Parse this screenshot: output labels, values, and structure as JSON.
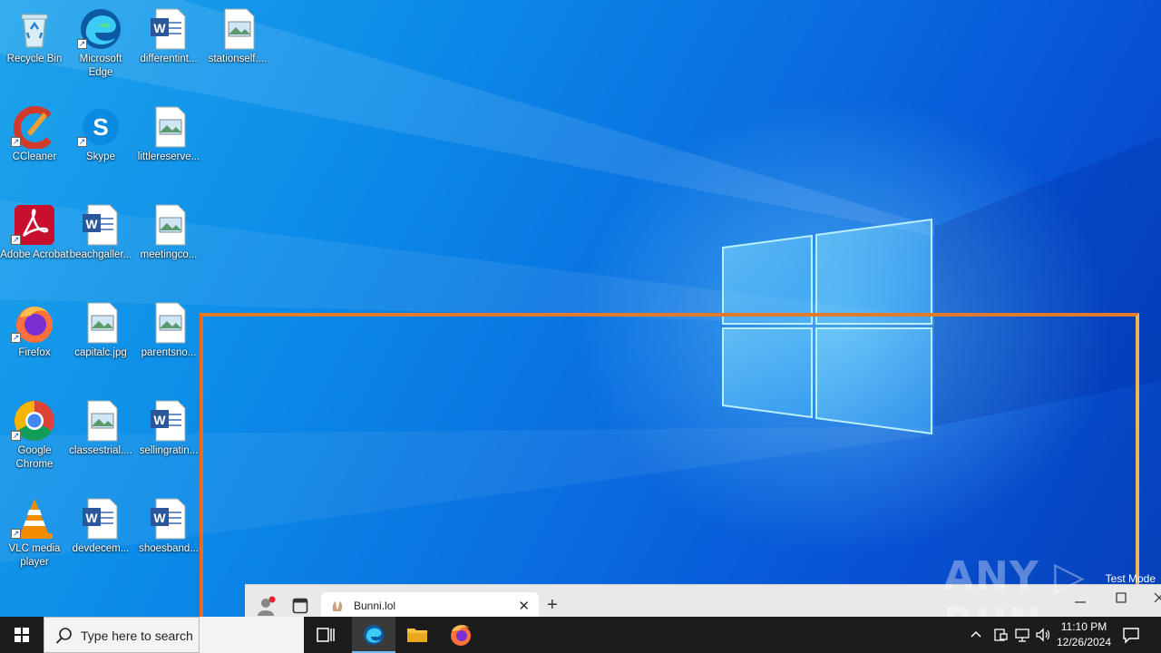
{
  "desktop_icons": [
    {
      "label": "Recycle Bin",
      "icon": "recycle-bin-icon"
    },
    {
      "label": "Microsoft Edge",
      "icon": "edge-icon"
    },
    {
      "label": "differentint...",
      "icon": "word-doc-icon"
    },
    {
      "label": "stationself....",
      "icon": "image-file-icon"
    },
    {
      "label": "CCleaner",
      "icon": "ccleaner-icon"
    },
    {
      "label": "Skype",
      "icon": "skype-icon"
    },
    {
      "label": "littlereserve...",
      "icon": "image-file-icon"
    },
    {
      "label": "Adobe Acrobat",
      "icon": "acrobat-icon"
    },
    {
      "label": "beachgaller...",
      "icon": "word-doc-icon"
    },
    {
      "label": "meetingco...",
      "icon": "image-file-icon"
    },
    {
      "label": "Firefox",
      "icon": "firefox-icon"
    },
    {
      "label": "capitalc.jpg",
      "icon": "image-file-icon"
    },
    {
      "label": "parentsno...",
      "icon": "image-file-icon"
    },
    {
      "label": "Google Chrome",
      "icon": "chrome-icon"
    },
    {
      "label": "classestrial....",
      "icon": "image-file-icon"
    },
    {
      "label": "sellingratin...",
      "icon": "word-doc-icon"
    },
    {
      "label": "VLC media player",
      "icon": "vlc-icon"
    },
    {
      "label": "devdecem...",
      "icon": "word-doc-icon"
    },
    {
      "label": "shoesband...",
      "icon": "word-doc-icon"
    }
  ],
  "browser": {
    "tab_title": "Bunni.lol",
    "close_glyph": "✕",
    "new_tab_glyph": "+"
  },
  "watermark": "ANY ▷ RUN",
  "test_mode": "Test Mode",
  "taskbar": {
    "search_placeholder": "Type here to search",
    "clock_time": "11:10 PM",
    "clock_date": "12/26/2024"
  },
  "colors": {
    "taskbar": "#1c1c1c",
    "selection_border": "#e86a25",
    "desktop_accent": "#0a6fe0"
  }
}
